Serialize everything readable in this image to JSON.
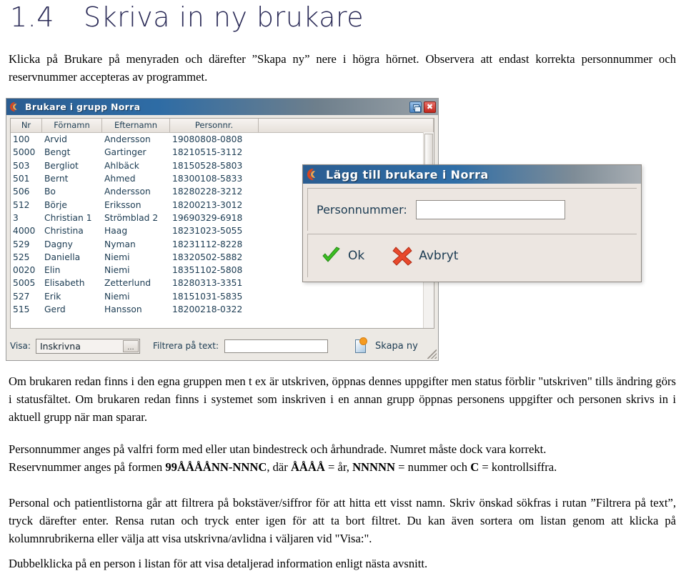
{
  "heading": {
    "number": "1.4",
    "title": "Skriva in ny brukare"
  },
  "paragraphs": {
    "intro": "Klicka på Brukare på menyraden och därefter ”Skapa ny” nere i högra hörnet.  Observera att endast korrekta personnummer och reservnummer accepteras av programmet.",
    "p1": "Om brukaren redan finns i den egna gruppen men t ex är utskriven, öppnas dennes uppgifter men status förblir \"utskriven\" tills ändring görs i statusfältet. Om brukaren redan finns i systemet som inskriven i en annan grupp öppnas personens uppgifter och personen skrivs in i aktuell grupp när man sparar.",
    "p2_line1": "Personnummer anges på valfri form med eller utan bindestreck och århundrade. Numret måste dock vara korrekt.",
    "p2_line2_pre": "Reservnummer anges på formen ",
    "p2_line2_b1": "99ÅÅÅÅNN-NNNC",
    "p2_line2_mid1": ", där ",
    "p2_line2_b2": "ÅÅÅÅ",
    "p2_line2_mid2": " = år, ",
    "p2_line2_b3": "NNNNN",
    "p2_line2_mid3": " = nummer och ",
    "p2_line2_b4": "C",
    "p2_line2_end": " = kontrollsiffra.",
    "p3": "Personal och patientlistorna går att filtrera på bokstäver/siffror för att hitta ett visst namn. Skriv önskad sökfras i rutan ”Filtrera på text”, tryck därefter enter. Rensa rutan och tryck enter igen för att ta bort filtret. Du kan även sortera om listan genom att klicka på kolumnrubrikerna eller välja att visa utskrivna/avlidna i väljaren vid \"Visa:\".",
    "p4": "Dubbelklicka på en person i listan för att visa detaljerad information enligt nästa avsnitt."
  },
  "app_window": {
    "title": "Brukare i grupp Norra",
    "icon": "app-logo-icon",
    "restore_button": "restore-icon",
    "close_button": "✖",
    "columns": [
      "Nr",
      "Förnamn",
      "Efternamn",
      "Personnr."
    ],
    "rows": [
      {
        "nr": "100",
        "fornamn": "Arvid",
        "efternamn": "Andersson",
        "personnr": "19080808-0808"
      },
      {
        "nr": "5000",
        "fornamn": "Bengt",
        "efternamn": "Gartinger",
        "personnr": "18210515-3112"
      },
      {
        "nr": "503",
        "fornamn": "Bergliot",
        "efternamn": "Ahlbäck",
        "personnr": "18150528-5803"
      },
      {
        "nr": "501",
        "fornamn": "Bernt",
        "efternamn": "Ahmed",
        "personnr": "18300108-5833"
      },
      {
        "nr": "506",
        "fornamn": "Bo",
        "efternamn": "Andersson",
        "personnr": "18280228-3212"
      },
      {
        "nr": "512",
        "fornamn": "Börje",
        "efternamn": "Eriksson",
        "personnr": "18200213-3012"
      },
      {
        "nr": "3",
        "fornamn": "Christian 1",
        "efternamn": "Strömblad 2",
        "personnr": "19690329-6918"
      },
      {
        "nr": "4000",
        "fornamn": "Christina",
        "efternamn": "Haag",
        "personnr": "18231023-5055"
      },
      {
        "nr": "529",
        "fornamn": "Dagny",
        "efternamn": "Nyman",
        "personnr": "18231112-8228"
      },
      {
        "nr": "525",
        "fornamn": "Daniella",
        "efternamn": "Niemi",
        "personnr": "18320502-5882"
      },
      {
        "nr": "0020",
        "fornamn": "Elin",
        "efternamn": "Niemi",
        "personnr": "18351102-5808"
      },
      {
        "nr": "5005",
        "fornamn": "Elisabeth",
        "efternamn": "Zetterlund",
        "personnr": "18280313-3351"
      },
      {
        "nr": "527",
        "fornamn": "Erik",
        "efternamn": "Niemi",
        "personnr": "18151031-5835"
      },
      {
        "nr": "515",
        "fornamn": "Gerd",
        "efternamn": "Hansson",
        "personnr": "18200218-0322"
      }
    ],
    "toolbar": {
      "visa_label": "Visa:",
      "visa_value": "Inskrivna",
      "visa_ellipsis": "...",
      "filter_label": "Filtrera på text:",
      "filter_value": "",
      "skapa_ny_label": "Skapa ny",
      "skapa_ny_icon": "new-document-icon"
    }
  },
  "dialog": {
    "title": "Lägg till brukare i Norra",
    "icon": "app-logo-icon",
    "field_label": "Personnummer:",
    "field_value": "",
    "ok_label": "Ok",
    "ok_icon": "green-check-icon",
    "cancel_label": "Avbryt",
    "cancel_icon": "red-x-icon"
  },
  "colors": {
    "heading": "#2b2b57",
    "titlebar_blue": "#2b5d91",
    "window_face": "#ece9e4",
    "list_text": "#1b3b52",
    "check_green": "#33b021",
    "x_red": "#e0452a"
  }
}
